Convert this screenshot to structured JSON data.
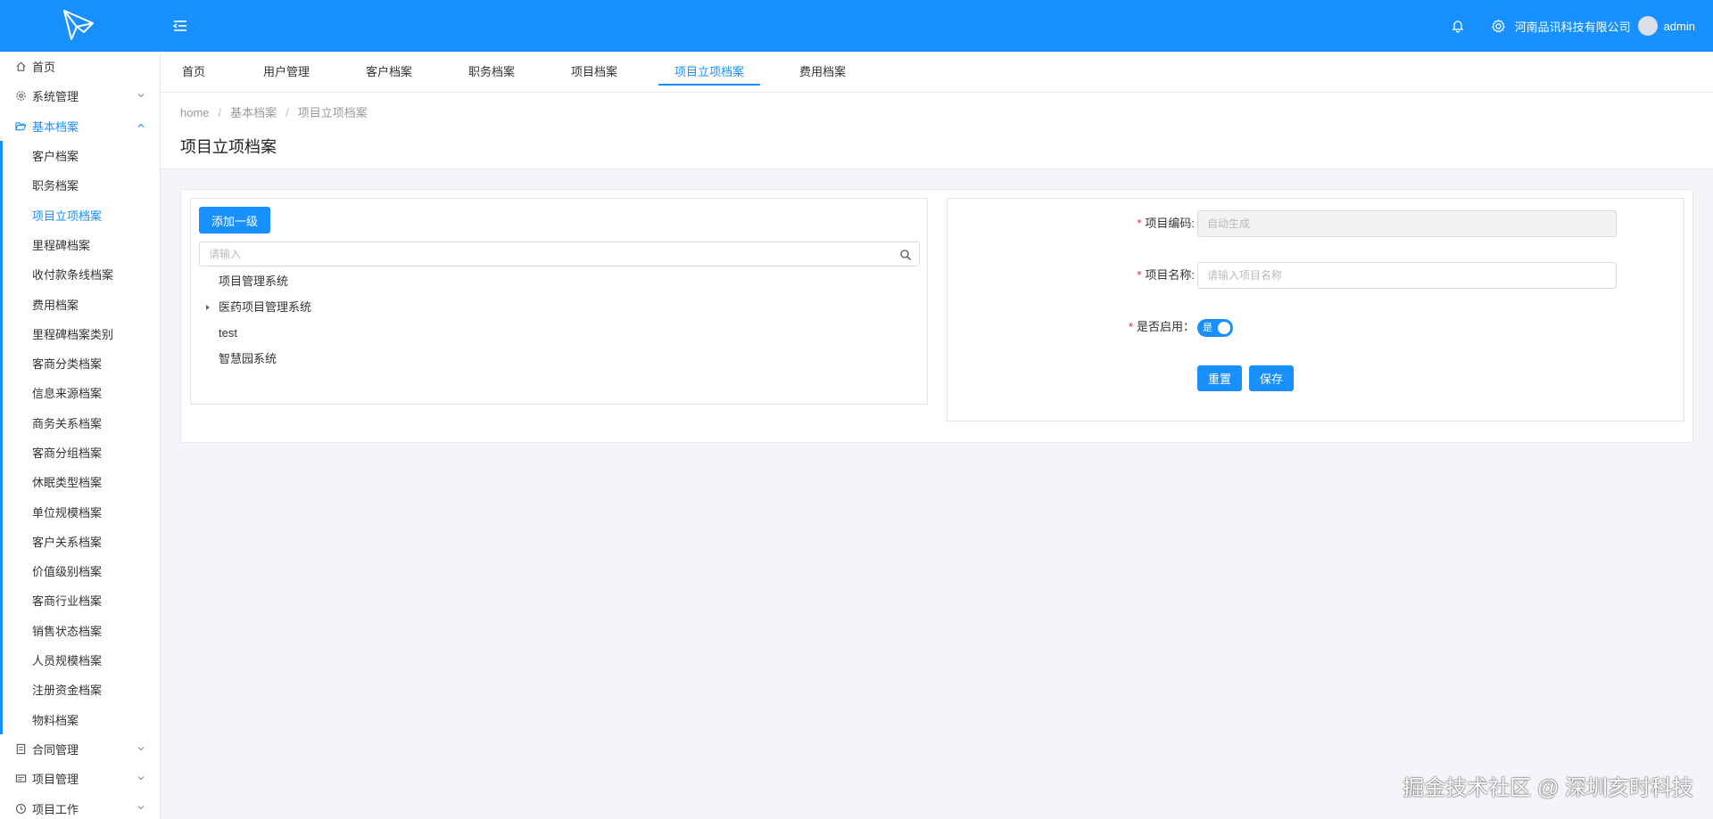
{
  "header": {
    "company": "河南品讯科技有限公司",
    "username": "admin",
    "colors": {
      "primary": "#1890ff"
    }
  },
  "sidebar": {
    "items": [
      {
        "label": "首页",
        "icon": "home-icon"
      },
      {
        "label": "系统管理",
        "icon": "gear-icon"
      },
      {
        "label": "基本档案",
        "icon": "folder-open-icon"
      }
    ],
    "basic_archive_children": [
      "客户档案",
      "职务档案",
      "项目立项档案",
      "里程碑档案",
      "收付款条线档案",
      "费用档案",
      "里程碑档案类别",
      "客商分类档案",
      "信息来源档案",
      "商务关系档案",
      "客商分组档案",
      "休眠类型档案",
      "单位规模档案",
      "客户关系档案",
      "价值级别档案",
      "客商行业档案",
      "销售状态档案",
      "人员规模档案",
      "注册资金档案",
      "物料档案"
    ],
    "bottom_items": [
      {
        "label": "合同管理",
        "icon": "contract-icon"
      },
      {
        "label": "项目管理",
        "icon": "list-icon"
      },
      {
        "label": "项目工作",
        "icon": "clock-icon"
      }
    ]
  },
  "tabs": [
    "首页",
    "用户管理",
    "客户档案",
    "职务档案",
    "项目档案",
    "项目立项档案",
    "费用档案"
  ],
  "breadcrumb": [
    "home",
    "基本档案",
    "项目立项档案"
  ],
  "page_title": "项目立项档案",
  "left_panel": {
    "add_button": "添加一级",
    "search_placeholder": "请输入",
    "tree": [
      "项目管理系统",
      "医药项目管理系统",
      "test",
      "智慧园系统"
    ]
  },
  "form": {
    "code_label": "项目编码:",
    "code_placeholder": "自动生成",
    "name_label": "项目名称:",
    "name_placeholder": "请输入项目名称",
    "enabled_label": "是否启用：",
    "enabled_text": "是",
    "enabled": true,
    "reset_button": "重置",
    "save_button": "保存"
  },
  "watermark": "掘金技术社区 @ 深圳亥时科技"
}
